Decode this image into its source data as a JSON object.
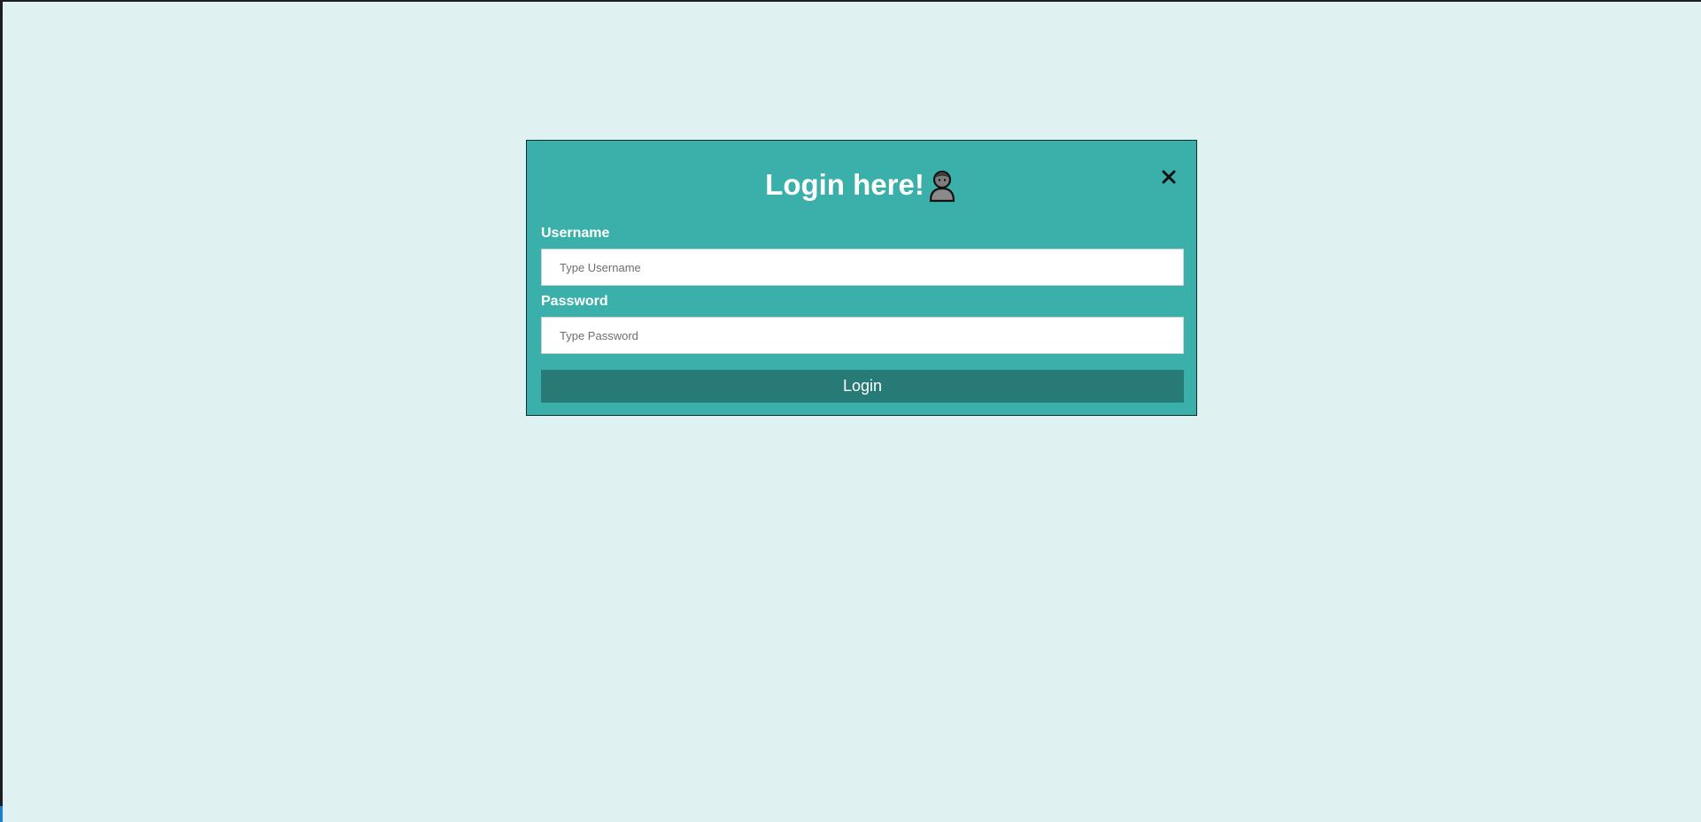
{
  "modal": {
    "title": "Login here!",
    "title_icon": "person-icon",
    "close_icon": "close-icon",
    "username": {
      "label": "Username",
      "placeholder": "Type Username",
      "value": ""
    },
    "password": {
      "label": "Password",
      "placeholder": "Type Password",
      "value": ""
    },
    "login_label": "Login"
  },
  "colors": {
    "page_background": "#dff2f1",
    "modal_background": "#3bb0aa",
    "button_background": "#287a76",
    "text_light": "#ffffff"
  }
}
